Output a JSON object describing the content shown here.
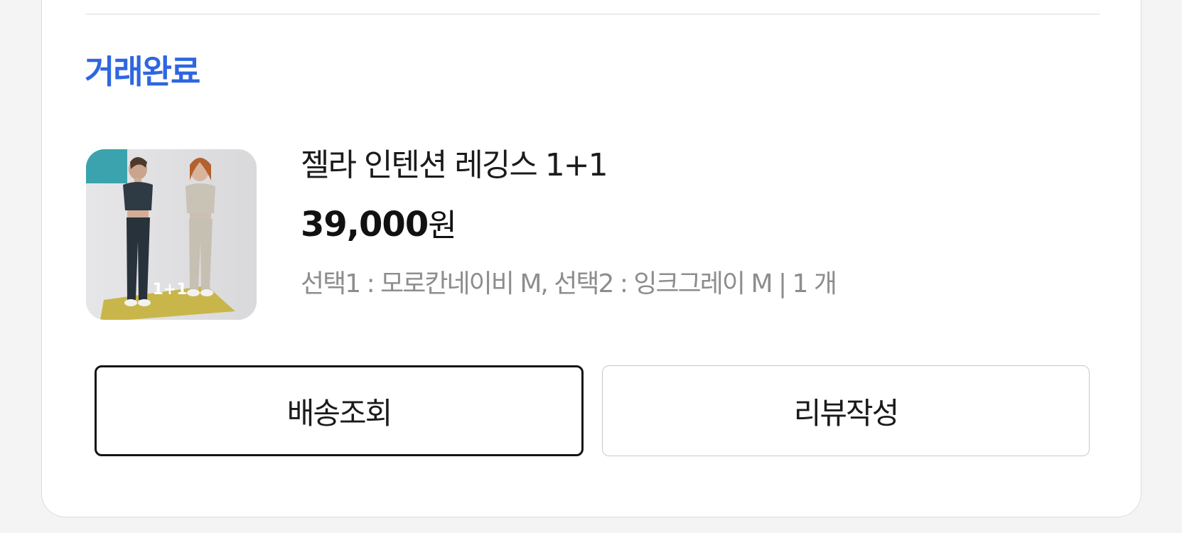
{
  "order": {
    "status": "거래완료",
    "status_color": "#2f66e0",
    "thumbnail_badge": "1+1",
    "product_name": "젤라 인텐션 레깅스 1+1",
    "price": "39,000",
    "currency": "원",
    "options": "선택1 : 모로칸네이비 M, 선택2 : 잉크그레이 M | 1 개"
  },
  "actions": {
    "track_delivery_label": "배송조회",
    "write_review_label": "리뷰작성"
  }
}
